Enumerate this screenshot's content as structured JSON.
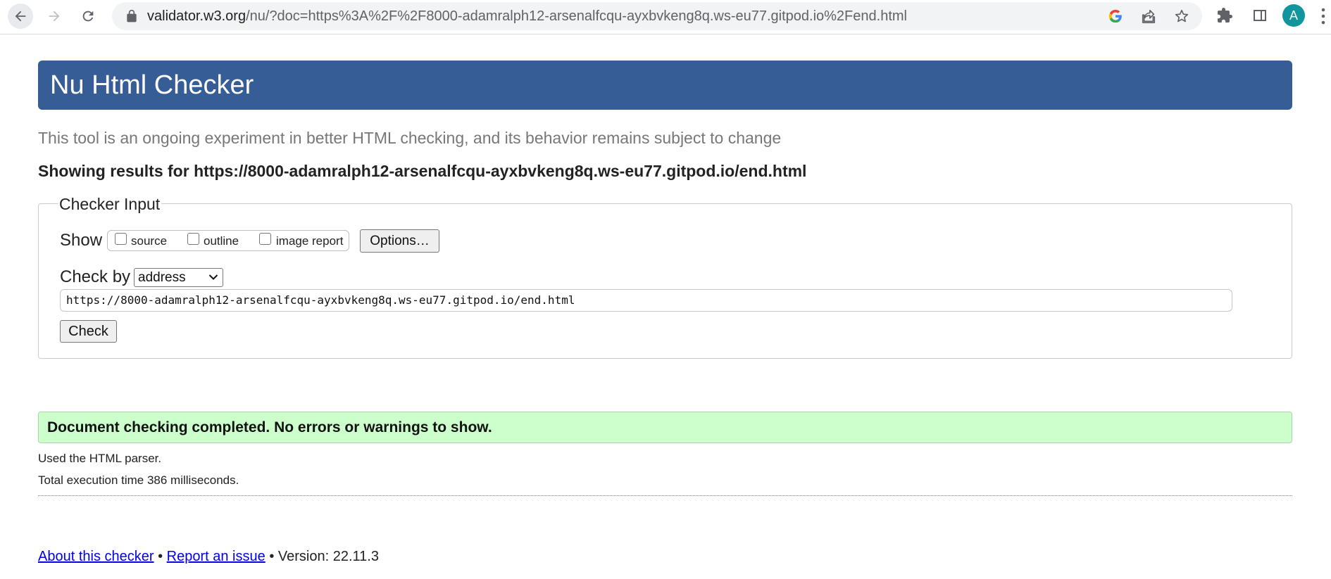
{
  "browser": {
    "url_host": "validator.w3.org",
    "url_path": "/nu/?doc=https%3A%2F%2F8000-adamralph12-arsenalfcqu-ayxbvkeng8q.ws-eu77.gitpod.io%2Fend.html",
    "avatar_letter": "A",
    "icons": [
      "back-arrow-icon",
      "forward-arrow-icon",
      "reload-icon",
      "lock-icon",
      "google-icon",
      "share-icon",
      "star-icon",
      "extensions-icon",
      "side-panel-icon",
      "kebab-menu-icon"
    ]
  },
  "page": {
    "title": "Nu Html Checker",
    "subtitle": "This tool is an ongoing experiment in better HTML checking, and its behavior remains subject to change",
    "showing_results": "Showing results for https://8000-adamralph12-arsenalfcqu-ayxbvkeng8q.ws-eu77.gitpod.io/end.html"
  },
  "checker_input": {
    "legend": "Checker Input",
    "show_label": "Show",
    "options": [
      {
        "label": "source",
        "checked": false
      },
      {
        "label": "outline",
        "checked": false
      },
      {
        "label": "image report",
        "checked": false
      }
    ],
    "options_button": "Options…",
    "check_by_label": "Check by",
    "check_by_value": "address",
    "address_value": "https://8000-adamralph12-arsenalfcqu-ayxbvkeng8q.ws-eu77.gitpod.io/end.html",
    "check_button": "Check"
  },
  "results": {
    "success_message": "Document checking completed. No errors or warnings to show.",
    "parser_info": "Used the HTML parser.",
    "execution_time": "Total execution time 386 milliseconds."
  },
  "footer": {
    "about_link": "About this checker",
    "separator": "•",
    "report_link": "Report an issue",
    "version": "Version: 22.11.3"
  },
  "colors": {
    "header_bg": "#365d95",
    "success_bg": "#ccffcc",
    "avatar_bg": "#12959c",
    "link": "#0000ee"
  }
}
